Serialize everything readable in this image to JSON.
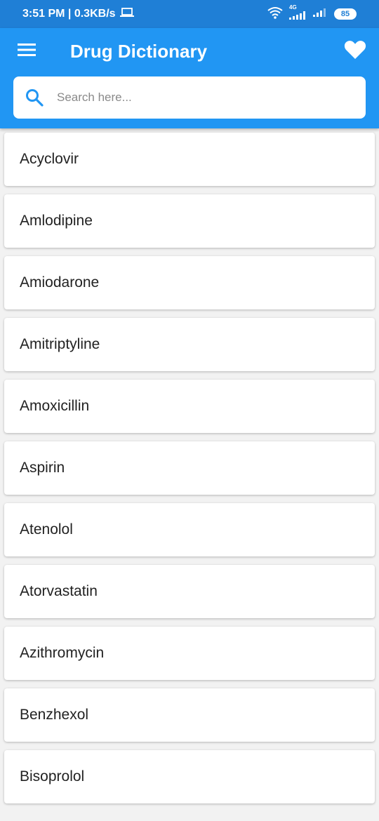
{
  "status_bar": {
    "time_speed": "3:51 PM | 0.3KB/s",
    "network_label": "4G",
    "battery": "85"
  },
  "app_bar": {
    "title": "Drug Dictionary",
    "menu_icon": "hamburger-menu-icon",
    "favorites_icon": "heart-icon"
  },
  "search": {
    "placeholder": "Search here...",
    "value": "",
    "icon": "search-icon"
  },
  "colors": {
    "status_bar": "#1f7fd6",
    "app_bar": "#2196f3",
    "background": "#f2f2f2",
    "card": "#ffffff"
  },
  "drugs": [
    "Acyclovir",
    "Amlodipine",
    "Amiodarone",
    "Amitriptyline",
    "Amoxicillin",
    "Aspirin",
    "Atenolol",
    "Atorvastatin",
    "Azithromycin",
    "Benzhexol",
    "Bisoprolol"
  ]
}
